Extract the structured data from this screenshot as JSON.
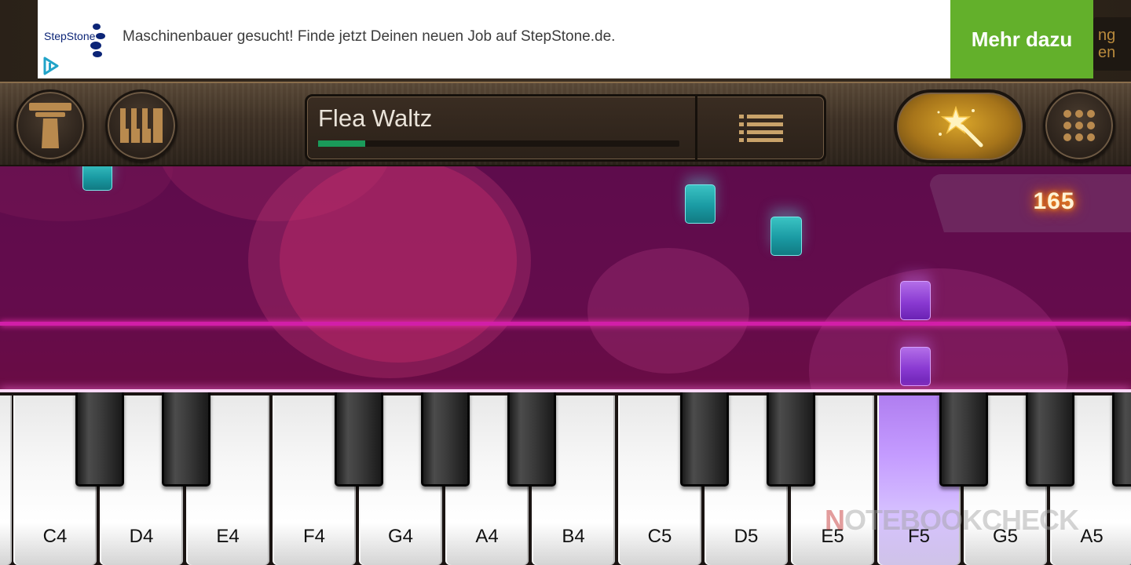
{
  "ad": {
    "brand": "StepStone",
    "text": "Maschinenbauer gesucht! Finde jetzt Deinen neuen Job auf StepStone.de.",
    "cta": "Mehr dazu",
    "behind_text": "ng\nen"
  },
  "toolbar": {
    "song_title": "Flea Waltz",
    "progress": 0.13
  },
  "score": "165",
  "keys": {
    "white": [
      "C4",
      "D4",
      "E4",
      "F4",
      "G4",
      "A4",
      "B4",
      "C5",
      "D5",
      "E5",
      "F5",
      "G5",
      "A5"
    ],
    "active": "F5"
  },
  "watermark": {
    "brand_prefix": "N",
    "brand_rest": "OTEBOOKCHECK"
  },
  "colors": {
    "play_bg": "#640c4c",
    "hit_line": "#d21ea8",
    "teal_note": "#1a9aa3",
    "purple_note": "#8a3ad2",
    "cta_bg": "#63b02b",
    "progress": "#1a9a5a"
  }
}
